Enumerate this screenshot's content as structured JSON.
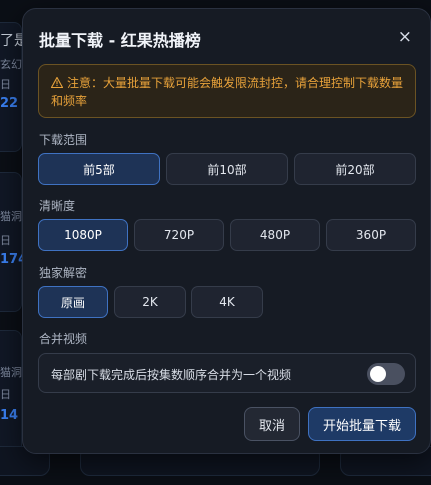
{
  "background": {
    "peek_texts": [
      "了是",
      "玄幻",
      "日",
      "22",
      "猫洞",
      "日",
      "174",
      "猫洞",
      "日",
      "14"
    ]
  },
  "modal": {
    "title": "批量下载 - 红果热播榜",
    "close_label": "×",
    "warning": "注意：大量批量下载可能会触发限流封控，请合理控制下载数量和频率",
    "range": {
      "label": "下载范围",
      "options": [
        "前5部",
        "前10部",
        "前20部"
      ],
      "selected": "前5部"
    },
    "quality": {
      "label": "清晰度",
      "options": [
        "1080P",
        "720P",
        "480P",
        "360P"
      ],
      "selected": "1080P"
    },
    "exclusive": {
      "label": "独家解密",
      "options": [
        "原画",
        "2K",
        "4K"
      ],
      "selected": "原画"
    },
    "merge": {
      "label": "合并视频",
      "description": "每部剧下载完成后按集数顺序合并为一个视频",
      "enabled": false
    },
    "cancel_label": "取消",
    "start_label": "开始批量下载"
  },
  "colors": {
    "accent": "#3f72c2",
    "warning": "#e8a23a",
    "modal_bg": "#161b24"
  }
}
